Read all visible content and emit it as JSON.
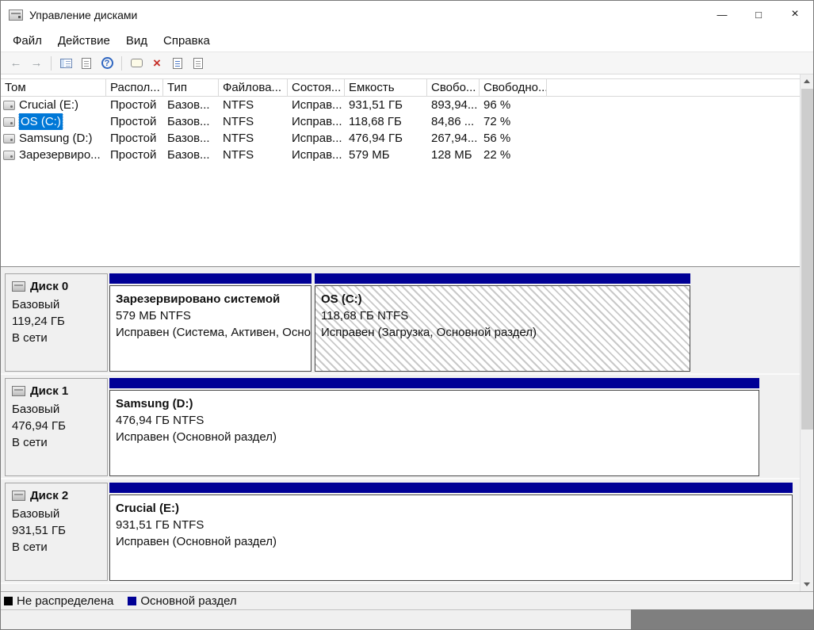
{
  "window": {
    "title": "Управление дисками",
    "minimize": "—",
    "maximize": "□",
    "close": "×"
  },
  "menubar": {
    "items": [
      "Файл",
      "Действие",
      "Вид",
      "Справка"
    ]
  },
  "toolbar": {
    "back": "←",
    "forward": "→",
    "help_glyph": "?",
    "delete_glyph": "×"
  },
  "volume_list": {
    "columns": [
      "Том",
      "Распол...",
      "Тип",
      "Файлова...",
      "Состоя...",
      "Емкость",
      "Свобо...",
      "Свободно..."
    ],
    "rows": [
      {
        "volume": "Crucial (E:)",
        "layout": "Простой",
        "type": "Базов...",
        "filesystem": "NTFS",
        "status": "Исправ...",
        "capacity": "931,51 ГБ",
        "free": "893,94...",
        "free_pct": "96 %"
      },
      {
        "volume": "OS (C:)",
        "layout": "Простой",
        "type": "Базов...",
        "filesystem": "NTFS",
        "status": "Исправ...",
        "capacity": "118,68 ГБ",
        "free": "84,86 ...",
        "free_pct": "72 %"
      },
      {
        "volume": "Samsung (D:)",
        "layout": "Простой",
        "type": "Базов...",
        "filesystem": "NTFS",
        "status": "Исправ...",
        "capacity": "476,94 ГБ",
        "free": "267,94...",
        "free_pct": "56 %"
      },
      {
        "volume": "Зарезервиро...",
        "layout": "Простой",
        "type": "Базов...",
        "filesystem": "NTFS",
        "status": "Исправ...",
        "capacity": "579 МБ",
        "free": "128 МБ",
        "free_pct": "22 %"
      }
    ]
  },
  "disks": [
    {
      "name": "Диск 0",
      "kind": "Базовый",
      "size": "119,24 ГБ",
      "status": "В сети",
      "partitions": [
        {
          "label": "Зарезервировано системой",
          "size": "579 МБ NTFS",
          "status": "Исправен (Система, Активен, Осно"
        },
        {
          "label": "OS  (C:)",
          "size": "118,68 ГБ NTFS",
          "status": "Исправен (Загрузка, Основной раздел)"
        }
      ]
    },
    {
      "name": "Диск 1",
      "kind": "Базовый",
      "size": "476,94 ГБ",
      "status": "В сети",
      "partitions": [
        {
          "label": "Samsung  (D:)",
          "size": "476,94 ГБ NTFS",
          "status": "Исправен (Основной раздел)"
        }
      ]
    },
    {
      "name": "Диск 2",
      "kind": "Базовый",
      "size": "931,51 ГБ",
      "status": "В сети",
      "partitions": [
        {
          "label": "Crucial  (E:)",
          "size": "931,51 ГБ NTFS",
          "status": "Исправен (Основной раздел)"
        }
      ]
    }
  ],
  "legend": {
    "unallocated": "Не распределена",
    "primary": "Основной раздел"
  },
  "colors": {
    "selection": "#0078d7",
    "partition_primary": "#000096",
    "unallocated": "#000000"
  }
}
